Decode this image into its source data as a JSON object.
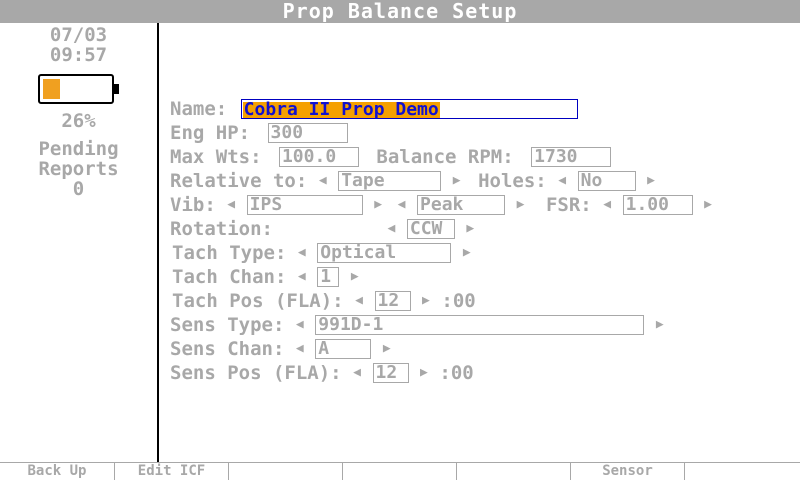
{
  "title": "Prop Balance Setup",
  "sidebar": {
    "date": "07/03",
    "time": "09:57",
    "battery_percent_label": "26%",
    "battery_level": 0.26,
    "pending_line1": "Pending",
    "pending_line2": "Reports",
    "pending_count": "0"
  },
  "form": {
    "name_label": "Name:",
    "name_value": "Cobra II Prop Demo",
    "eng_hp_label": "Eng HP:",
    "eng_hp_value": "300",
    "max_wts_label": "Max Wts:",
    "max_wts_value": "100.0",
    "balance_rpm_label": "Balance RPM:",
    "balance_rpm_value": "1730",
    "relative_label": "Relative to:",
    "relative_value": "Tape",
    "holes_label": "Holes:",
    "holes_value": "No",
    "vib_label": "Vib:",
    "vib_value": "IPS",
    "vib_mode_value": "Peak",
    "fsr_label": "FSR:",
    "fsr_value": "1.00",
    "rotation_label": "Rotation:",
    "rotation_value": "CCW",
    "tach_type_label": "Tach Type:",
    "tach_type_value": "Optical",
    "tach_chan_label": "Tach Chan:",
    "tach_chan_value": "1",
    "tach_pos_label": "Tach Pos (FLA):",
    "tach_pos_value": "12",
    "tach_pos_suffix": ":00",
    "sens_type_label": "Sens Type:",
    "sens_type_value": "991D-1",
    "sens_chan_label": "Sens Chan:",
    "sens_chan_value": "A",
    "sens_pos_label": "Sens Pos (FLA):",
    "sens_pos_value": "12",
    "sens_pos_suffix": ":00"
  },
  "function_keys": [
    "Back Up",
    "Edit ICF",
    "",
    "",
    "",
    "Sensor",
    ""
  ],
  "colors": {
    "accent": "#f5a000",
    "selection_text": "#1010d0",
    "dim_text": "#a8a8a8",
    "battery": "#f0a020"
  }
}
